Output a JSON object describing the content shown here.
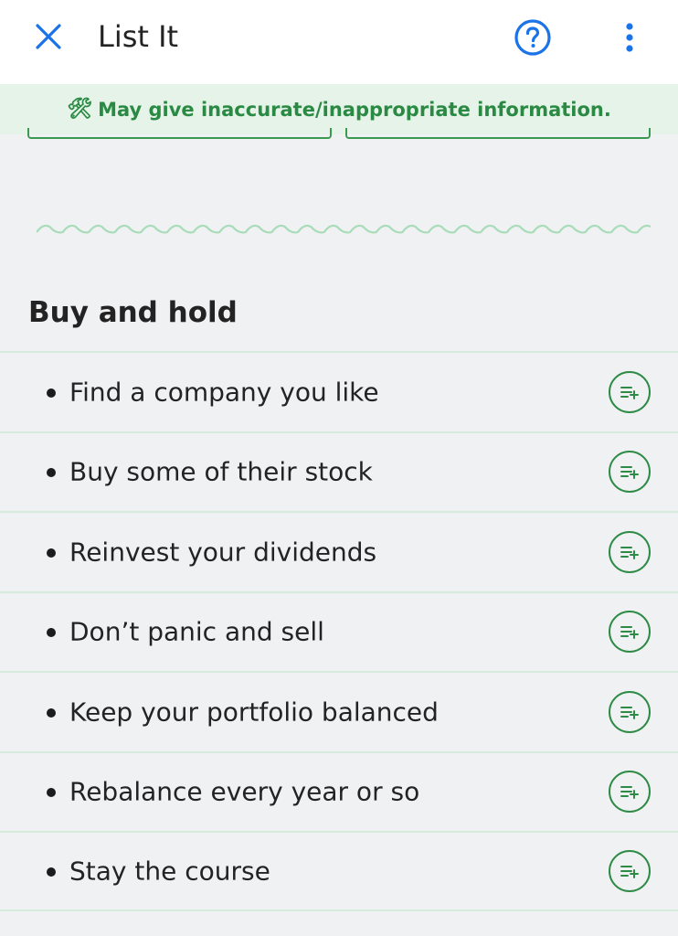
{
  "header": {
    "title": "List It",
    "close_icon": "close-icon",
    "help_icon": "help-circle-icon",
    "more_icon": "more-vertical-icon",
    "accent_color": "#1a73e8"
  },
  "banner": {
    "icon": "🛠",
    "text": "May give inaccurate/inappropriate information.",
    "text_color": "#2a8a43",
    "background": "#e5f3e9"
  },
  "section": {
    "title": "Buy and hold",
    "items": [
      {
        "label": "Find a company you like"
      },
      {
        "label": "Buy some of their stock"
      },
      {
        "label": "Reinvest your dividends"
      },
      {
        "label": "Don’t panic and sell"
      },
      {
        "label": "Keep your portfolio balanced"
      },
      {
        "label": "Rebalance every year or so"
      },
      {
        "label": "Stay the course"
      }
    ],
    "item_action_icon": "playlist-add-icon",
    "action_color": "#2e8b46"
  }
}
